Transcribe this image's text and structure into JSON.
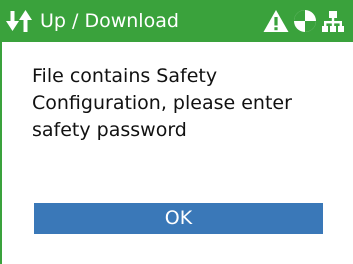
{
  "colors": {
    "title_bar": "#3aa23c",
    "button": "#3a78b8",
    "text": "#111111"
  },
  "title_bar": {
    "icon": "up-download-icon",
    "title": "Up / Download",
    "status_icons": [
      "warning-icon",
      "safety-icon",
      "network-icon"
    ]
  },
  "dialog": {
    "message_lines": [
      "File contains Safety",
      "Configuration, please enter",
      "safety password"
    ],
    "ok_label": "OK"
  }
}
